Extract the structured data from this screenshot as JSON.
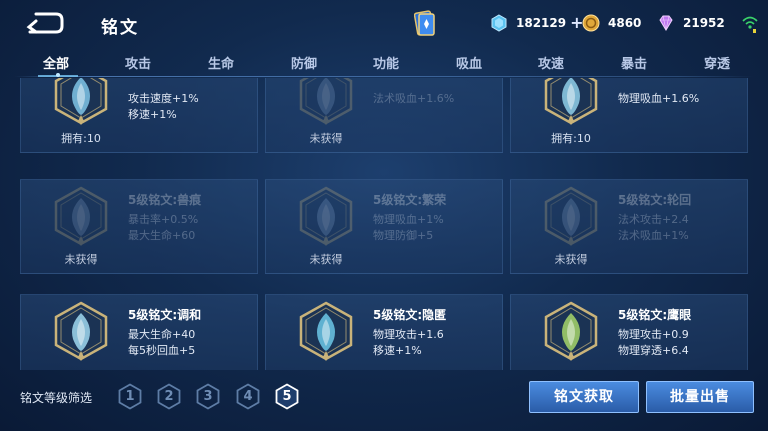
{
  "header": {
    "title": "铭文",
    "diamond": "182129",
    "gold": "4860",
    "gem": "21952"
  },
  "tabs": [
    {
      "label": "全部",
      "active": true
    },
    {
      "label": "攻击"
    },
    {
      "label": "生命"
    },
    {
      "label": "防御"
    },
    {
      "label": "功能"
    },
    {
      "label": "吸血"
    },
    {
      "label": "攻速"
    },
    {
      "label": "暴击"
    },
    {
      "label": "穿透"
    }
  ],
  "cards": [
    {
      "title": "",
      "stat1": "攻击速度+1%",
      "stat2": "移速+1%",
      "status": "拥有:10",
      "locked": false,
      "color": "#7fc6e8"
    },
    {
      "title": "",
      "stat1": "法术吸血+1.6%",
      "stat2": "",
      "status": "未获得",
      "locked": true,
      "color": "#8aa6c8"
    },
    {
      "title": "",
      "stat1": "物理吸血+1.6%",
      "stat2": "",
      "status": "拥有:10",
      "locked": false,
      "color": "#8fd0ea"
    },
    {
      "title": "5级铭文:兽痕",
      "stat1": "暴击率+0.5%",
      "stat2": "最大生命+60",
      "status": "未获得",
      "locked": true,
      "color": "#8aa6c8"
    },
    {
      "title": "5级铭文:繁荣",
      "stat1": "物理吸血+1%",
      "stat2": "物理防御+5",
      "status": "未获得",
      "locked": true,
      "color": "#8aa6c8"
    },
    {
      "title": "5级铭文:轮回",
      "stat1": "法术攻击+2.4",
      "stat2": "法术吸血+1%",
      "status": "未获得",
      "locked": true,
      "color": "#8aa6c8"
    },
    {
      "title": "5级铭文:调和",
      "stat1": "最大生命+40",
      "stat2": "每5秒回血+5",
      "status": "",
      "locked": false,
      "color": "#9fd8f0"
    },
    {
      "title": "5级铭文:隐匿",
      "stat1": "物理攻击+1.6",
      "stat2": "移速+1%",
      "status": "",
      "locked": false,
      "color": "#6cc8e8"
    },
    {
      "title": "5级铭文:鹰眼",
      "stat1": "物理攻击+0.9",
      "stat2": "物理穿透+6.4",
      "status": "",
      "locked": false,
      "color": "#a6d66a"
    }
  ],
  "footer": {
    "filter_label": "铭文等级筛选",
    "levels": [
      "1",
      "2",
      "3",
      "4",
      "5"
    ],
    "selected_level": "5",
    "acquire_label": "铭文获取",
    "bulk_sell_label": "批量出售"
  },
  "colors": {
    "accent": "#4b8ce0",
    "gold_frame": "#c9b37a",
    "background": "#112a4e"
  }
}
